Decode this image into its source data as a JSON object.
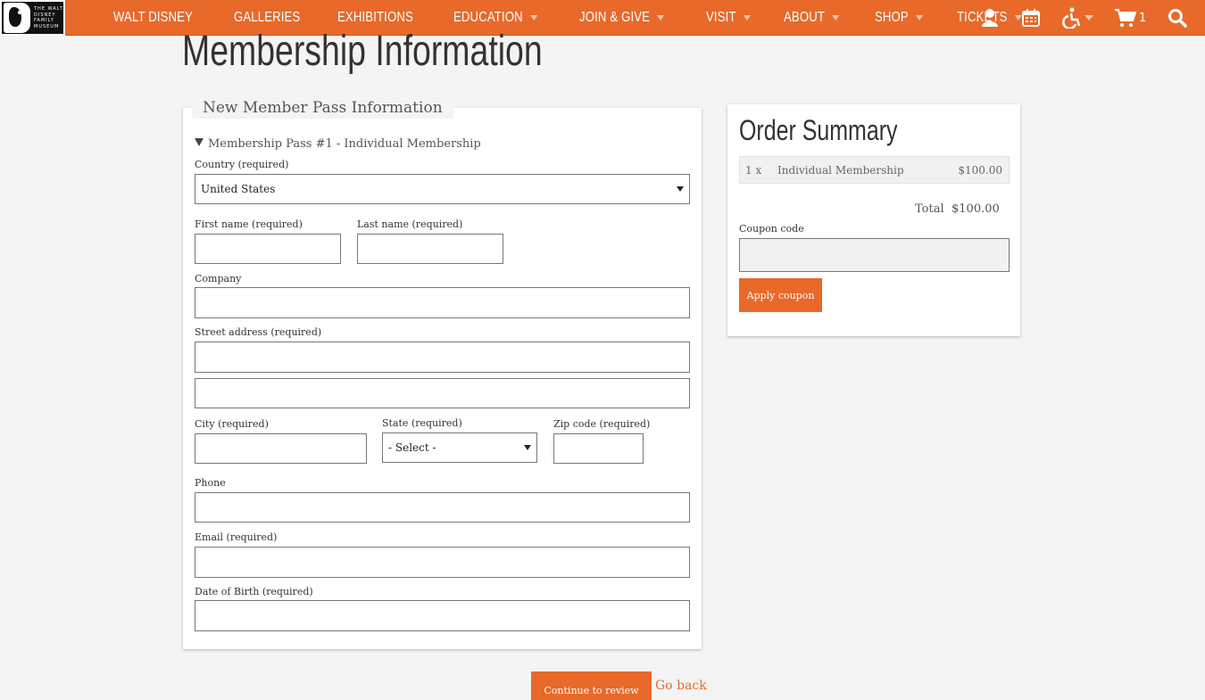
{
  "nav": {
    "logo_text": [
      "THE WALT",
      "DISNEY",
      "FAMILY",
      "MUSEUM"
    ],
    "items": [
      {
        "label": "WALT DISNEY",
        "dropdown": false
      },
      {
        "label": "GALLERIES",
        "dropdown": false
      },
      {
        "label": "EXHIBITIONS",
        "dropdown": false
      },
      {
        "label": "EDUCATION",
        "dropdown": true
      },
      {
        "label": "JOIN & GIVE",
        "dropdown": true
      },
      {
        "label": "VISIT",
        "dropdown": true
      },
      {
        "label": "ABOUT",
        "dropdown": true
      },
      {
        "label": "SHOP",
        "dropdown": true
      },
      {
        "label": "TICKETS",
        "dropdown": true
      }
    ],
    "cart_count": "1",
    "icons": [
      "user-icon",
      "calendar-icon",
      "accessibility-icon",
      "cart-icon",
      "search-icon"
    ]
  },
  "page": {
    "title": "Membership Information"
  },
  "form": {
    "legend": "New Member Pass Information",
    "pass_title": "Membership Pass #1 - Individual Membership",
    "country_label": "Country (required)",
    "country_value": "United States",
    "first_name_label": "First name (required)",
    "last_name_label": "Last name (required)",
    "company_label": "Company",
    "street_label": "Street address (required)",
    "city_label": "City (required)",
    "state_label": "State (required)",
    "state_value": "- Select -",
    "zip_label": "Zip code (required)",
    "phone_label": "Phone",
    "email_label": "Email (required)",
    "dob_label": "Date of Birth (required)",
    "continue_label": "Continue to review",
    "back_label": "Go back"
  },
  "summary": {
    "title": "Order Summary",
    "item_qty": "1 x",
    "item_name": "Individual Membership",
    "item_price": "$100.00",
    "total_label": "Total",
    "total_value": "$100.00",
    "coupon_label": "Coupon code",
    "coupon_button": "Apply coupon"
  },
  "colors": {
    "accent": "#e8692a",
    "background": "#f4f4f4"
  }
}
